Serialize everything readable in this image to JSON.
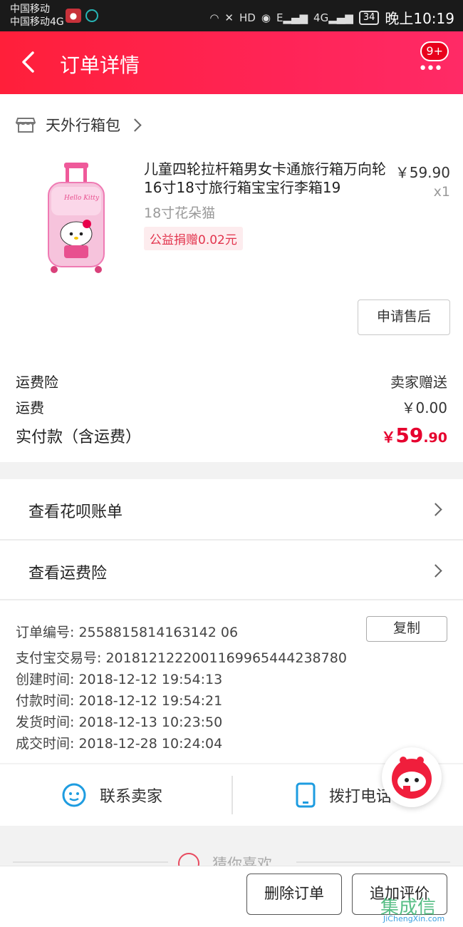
{
  "status_bar": {
    "carrier_1": "中国移动",
    "carrier_2": "中国移动4G",
    "signal_1": "E",
    "signal_2": "4G",
    "battery": "34",
    "time": "晚上10:19"
  },
  "header": {
    "title": "订单详情",
    "badge": "9+",
    "more_icon": "ellipsis-icon"
  },
  "shop": {
    "name": "天外行箱包"
  },
  "product": {
    "title": "儿童四轮拉杆箱男女卡通旅行箱万向轮16寸18寸旅行箱宝宝行李箱19",
    "price": "￥59.90",
    "qty": "x1",
    "spec": "18寸花朵猫",
    "tag": "公益捐赠0.02元",
    "image_text": "Hello Kitty"
  },
  "after_sale_button": "申请售后",
  "fees": {
    "insurance_label": "运费险",
    "insurance_value": "卖家赠送",
    "shipping_label": "运费",
    "shipping_value": "￥0.00",
    "total_label": "实付款（含运费）",
    "total_currency": "￥",
    "total_int": "59",
    "total_dec": ".90"
  },
  "links": {
    "huabei": "查看花呗账单",
    "freight_insurance": "查看运费险"
  },
  "order_info": {
    "order_no": "订单编号: 2558815814163142 06",
    "alipay_no": "支付宝交易号: 2018121222001169965444238780",
    "created": "创建时间: 2018-12-12 19:54:13",
    "paid": "付款时间: 2018-12-12 19:54:21",
    "shipped": "发货时间: 2018-12-13 10:23:50",
    "completed": "成交时间: 2018-12-28 10:24:04",
    "copy_button": "复制"
  },
  "contact": {
    "seller": "联系卖家",
    "phone": "拨打电话"
  },
  "guess": {
    "title": "猜你喜欢"
  },
  "bottom": {
    "delete": "删除订单",
    "review": "追加评价"
  },
  "watermark": {
    "main": "集成信",
    "sub": "JiChengXin.com"
  },
  "colors": {
    "header_red": "#ff2456",
    "price_red": "#e6002e",
    "tag_bg": "#fdecee",
    "tag_text": "#e2344d",
    "icon_blue": "#1e9ce0"
  }
}
